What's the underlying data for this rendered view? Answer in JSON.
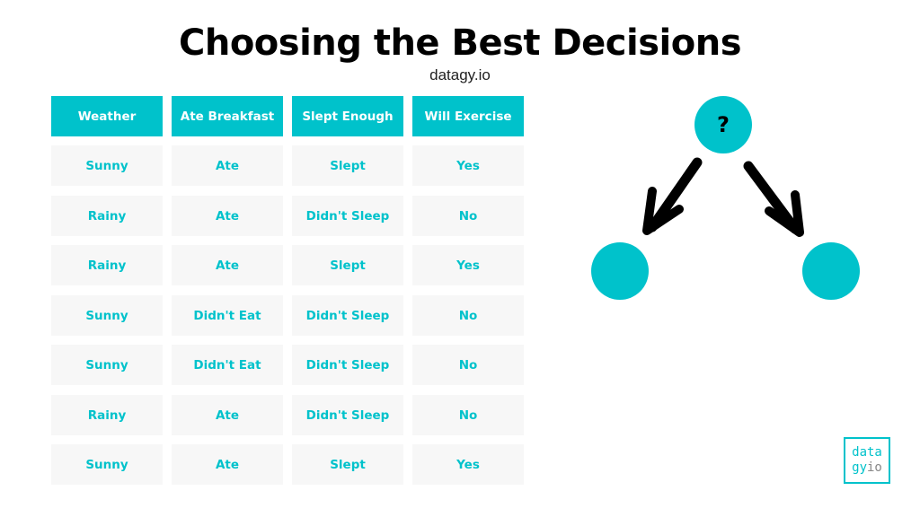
{
  "header": {
    "title": "Choosing the Best Decisions",
    "subtitle": "datagy.io"
  },
  "colors": {
    "accent": "#00c2cb",
    "cell_background": "#f7f7f7",
    "header_text": "#ffffff",
    "arrow": "#000000",
    "logo_gray": "#888888"
  },
  "table": {
    "columns": [
      "Weather",
      "Ate Breakfast",
      "Slept Enough",
      "Will Exercise"
    ],
    "rows": [
      [
        "Sunny",
        "Ate",
        "Slept",
        "Yes"
      ],
      [
        "Rainy",
        "Ate",
        "Didn't Sleep",
        "No"
      ],
      [
        "Rainy",
        "Ate",
        "Slept",
        "Yes"
      ],
      [
        "Sunny",
        "Didn't Eat",
        "Didn't Sleep",
        "No"
      ],
      [
        "Sunny",
        "Didn't Eat",
        "Didn't Sleep",
        "No"
      ],
      [
        "Rainy",
        "Ate",
        "Didn't Sleep",
        "No"
      ],
      [
        "Sunny",
        "Ate",
        "Slept",
        "Yes"
      ]
    ]
  },
  "tree": {
    "root_label": "?",
    "left_label": "",
    "right_label": ""
  },
  "logo": {
    "line1": "data",
    "line2_a": "gy",
    "line2_b": "io"
  }
}
